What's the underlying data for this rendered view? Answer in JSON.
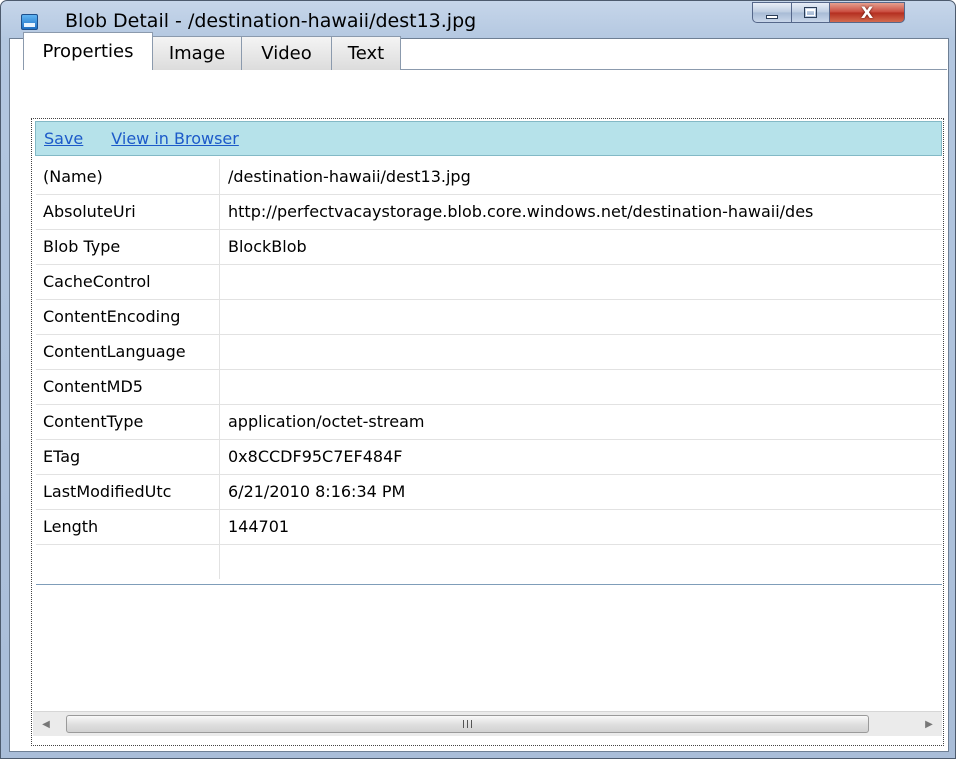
{
  "window": {
    "title": "Blob Detail - /destination-hawaii/dest13.jpg",
    "icon": "app-window-icon"
  },
  "caption_buttons": {
    "minimize_icon": "minimize-icon",
    "maximize_icon": "maximize-icon",
    "close_glyph": "X"
  },
  "tabs": [
    {
      "label": "Properties",
      "active": true
    },
    {
      "label": "Image",
      "active": false
    },
    {
      "label": "Video",
      "active": false
    },
    {
      "label": "Text",
      "active": false
    }
  ],
  "toolbar": {
    "save_label": "Save",
    "view_in_browser_label": "View in Browser"
  },
  "properties": [
    {
      "name": "(Name)",
      "value": "/destination-hawaii/dest13.jpg"
    },
    {
      "name": "AbsoluteUri",
      "value": "http://perfectvacaystorage.blob.core.windows.net/destination-hawaii/des"
    },
    {
      "name": "Blob Type",
      "value": "BlockBlob"
    },
    {
      "name": "CacheControl",
      "value": ""
    },
    {
      "name": "ContentEncoding",
      "value": ""
    },
    {
      "name": "ContentLanguage",
      "value": ""
    },
    {
      "name": "ContentMD5",
      "value": ""
    },
    {
      "name": "ContentType",
      "value": "application/octet-stream"
    },
    {
      "name": "ETag",
      "value": "0x8CCDF95C7EF484F"
    },
    {
      "name": "LastModifiedUtc",
      "value": "6/21/2010 8:16:34 PM"
    },
    {
      "name": "Length",
      "value": "144701"
    },
    {
      "name": "",
      "value": ""
    }
  ],
  "colors": {
    "toolbar_bg": "#b6e2ea",
    "link": "#1c5ac9",
    "close_button": "#c8473a"
  }
}
